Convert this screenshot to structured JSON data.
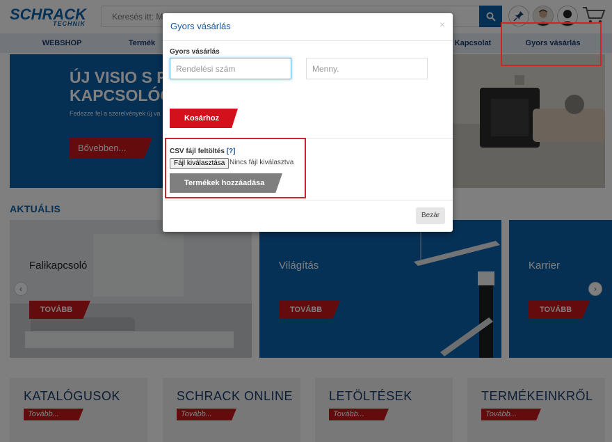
{
  "brand": {
    "logo_main": "SCHRACK",
    "logo_sub": "TECHNIK",
    "accent": "#0a5fa6",
    "red": "#c8161d"
  },
  "search": {
    "placeholder": "Keresés itt: Mi"
  },
  "header_icons": [
    "search-icon",
    "pin-icon",
    "avatar",
    "user-icon",
    "cart-icon"
  ],
  "nav": {
    "items": [
      "WEBSHOP",
      "Termék",
      "Kapcsolat",
      "Gyors vásárlás"
    ]
  },
  "hero": {
    "title": "ÚJ VISIO S FA\nKAPCSOLÓCS",
    "subtitle": "Fedezze fel a szerelvények új va",
    "button": "Bővebben..."
  },
  "aktualis": {
    "heading": "AKTUÁLIS",
    "cards": [
      {
        "label": "Falikapcsoló",
        "button": "TOVÁBB"
      },
      {
        "label": "Világítás",
        "button": "TOVÁBB"
      },
      {
        "label": "Karrier",
        "button": "TOVÁBB"
      }
    ],
    "prev_icon": "chevron-left-icon",
    "next_icon": "chevron-right-icon"
  },
  "tiles": [
    {
      "title": "KATALÓGUSOK",
      "button": "Tovább..."
    },
    {
      "title": "SCHRACK ONLINE",
      "button": "Tovább..."
    },
    {
      "title": "LETÖLTÉSEK",
      "button": "Tovább..."
    },
    {
      "title": "TERMÉKEINKRŐL",
      "button": "Tovább..."
    }
  ],
  "modal": {
    "title": "Gyors vásárlás",
    "close_glyph": "×",
    "section_label": "Gyors vásárlás",
    "order_number_placeholder": "Rendelési szám",
    "quantity_placeholder": "Menny.",
    "add_to_cart": "Kosárhoz",
    "csv_label": "CSV fájl feltöltés",
    "csv_help": "[?]",
    "file_choose": "Fájl kiválasztása",
    "file_status": "Nincs fájl kiválasztva",
    "add_products": "Termékek hozzáadása",
    "close_button": "Bezár"
  }
}
